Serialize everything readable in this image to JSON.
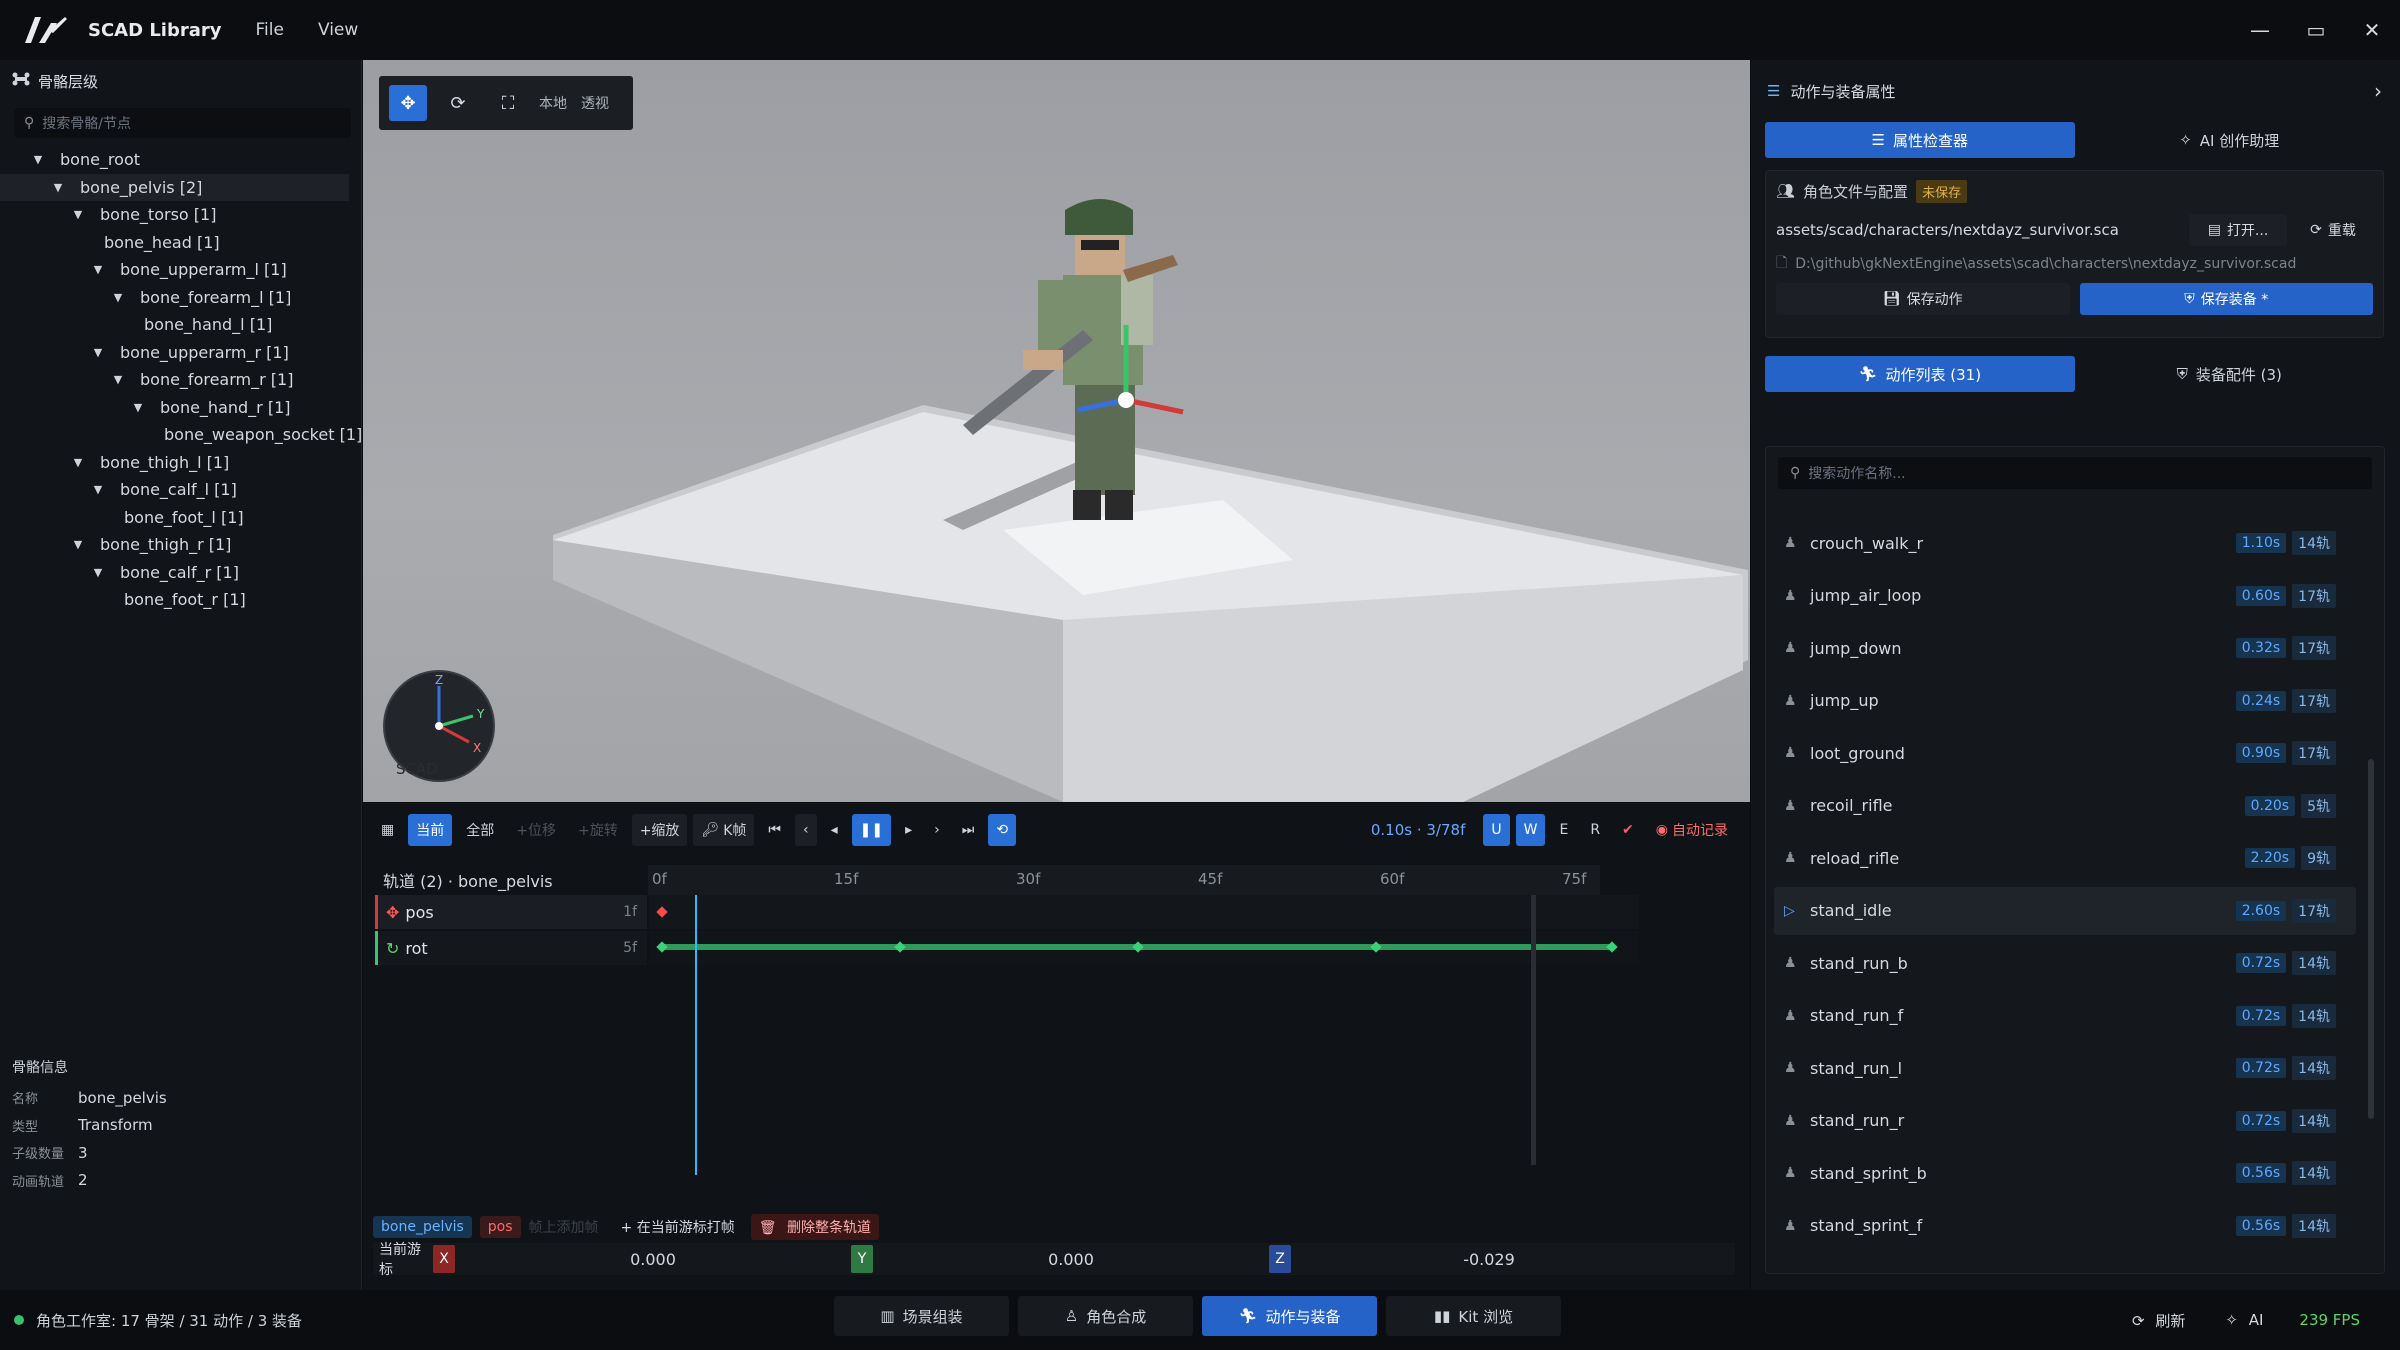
{
  "titlebar": {
    "app_title": "SCAD Library",
    "menu": [
      "File",
      "View"
    ],
    "min": "—",
    "max": "▭",
    "close": "✕"
  },
  "left": {
    "panel_title": "骨骼层级",
    "search_placeholder": "搜索骨骼/节点",
    "tree": [
      {
        "label": "bone_root",
        "depth": 0,
        "expand": true
      },
      {
        "label": "bone_pelvis  [2]",
        "depth": 1,
        "expand": true,
        "selected": true
      },
      {
        "label": "bone_torso  [1]",
        "depth": 2,
        "expand": true
      },
      {
        "label": "bone_head  [1]",
        "depth": 3,
        "expand": false
      },
      {
        "label": "bone_upperarm_l  [1]",
        "depth": 3,
        "expand": true
      },
      {
        "label": "bone_forearm_l  [1]",
        "depth": 4,
        "expand": true
      },
      {
        "label": "bone_hand_l  [1]",
        "depth": 5,
        "expand": false
      },
      {
        "label": "bone_upperarm_r  [1]",
        "depth": 3,
        "expand": true
      },
      {
        "label": "bone_forearm_r  [1]",
        "depth": 4,
        "expand": true
      },
      {
        "label": "bone_hand_r  [1]",
        "depth": 5,
        "expand": true
      },
      {
        "label": "bone_weapon_socket  [1]",
        "depth": 6,
        "expand": false
      },
      {
        "label": "bone_thigh_l  [1]",
        "depth": 2,
        "expand": true
      },
      {
        "label": "bone_calf_l  [1]",
        "depth": 3,
        "expand": true
      },
      {
        "label": "bone_foot_l  [1]",
        "depth": 4,
        "expand": false
      },
      {
        "label": "bone_thigh_r  [1]",
        "depth": 2,
        "expand": true
      },
      {
        "label": "bone_calf_r  [1]",
        "depth": 3,
        "expand": true
      },
      {
        "label": "bone_foot_r  [1]",
        "depth": 4,
        "expand": false
      }
    ],
    "info_title": "骨骼信息",
    "info": [
      {
        "k": "名称",
        "v": "bone_pelvis"
      },
      {
        "k": "类型",
        "v": "Transform"
      },
      {
        "k": "子级数量",
        "v": "3"
      },
      {
        "k": "动画轨道",
        "v": "2"
      }
    ]
  },
  "viewport": {
    "local": "本地",
    "persp": "透视",
    "gizmo_label": "SCAD",
    "axes": [
      "Z",
      "Y",
      "X"
    ]
  },
  "timeline": {
    "current": "当前",
    "all": "全部",
    "add_move": "+位移",
    "add_rot": "+旋转",
    "add_scale": "+缩放",
    "kframe": "K帧",
    "time": "0.10s · 3/78f",
    "w": "W",
    "e": "E",
    "r": "R",
    "auto_record": "自动记录",
    "track_header": "轨道 (2) · bone_pelvis",
    "ruler": [
      "0f",
      "15f",
      "30f",
      "45f",
      "60f",
      "75f"
    ],
    "tracks": [
      {
        "name": "pos",
        "count": "1f"
      },
      {
        "name": "rot",
        "count": "5f"
      }
    ],
    "edit": {
      "bone": "bone_pelvis",
      "channel": "pos",
      "hint": "帧上添加帧",
      "add_key": "+ 在当前游标打帧",
      "delete_track": "删除整条轨道"
    },
    "cursor_label": "当前游标",
    "values": {
      "x": "0.000",
      "y": "0.000",
      "z": "-0.029"
    }
  },
  "right": {
    "panel_title": "动作与装备属性",
    "tabs": [
      "属性检查器",
      "AI 创作助理"
    ],
    "card_title": "角色文件与配置",
    "unsaved": "未保存",
    "asset_path": "assets/scad/characters/nextdayz_survivor.sca",
    "open": "打开...",
    "reload": "重载",
    "full_path": "D:\\github\\gkNextEngine\\assets\\scad\\characters\\nextdayz_survivor.scad",
    "save_action": "保存动作",
    "save_equip": "保存装备 *",
    "list_tabs": [
      "动作列表 (31)",
      "装备配件 (3)"
    ],
    "list_search": "搜索动作名称...",
    "actions": [
      {
        "name": "crouch_walk_r",
        "dur": "1.10s",
        "tracks": "14轨"
      },
      {
        "name": "jump_air_loop",
        "dur": "0.60s",
        "tracks": "17轨"
      },
      {
        "name": "jump_down",
        "dur": "0.32s",
        "tracks": "17轨"
      },
      {
        "name": "jump_up",
        "dur": "0.24s",
        "tracks": "17轨"
      },
      {
        "name": "loot_ground",
        "dur": "0.90s",
        "tracks": "17轨"
      },
      {
        "name": "recoil_rifle",
        "dur": "0.20s",
        "tracks": "5轨"
      },
      {
        "name": "reload_rifle",
        "dur": "2.20s",
        "tracks": "9轨"
      },
      {
        "name": "stand_idle",
        "dur": "2.60s",
        "tracks": "17轨",
        "selected": true
      },
      {
        "name": "stand_run_b",
        "dur": "0.72s",
        "tracks": "14轨"
      },
      {
        "name": "stand_run_f",
        "dur": "0.72s",
        "tracks": "14轨"
      },
      {
        "name": "stand_run_l",
        "dur": "0.72s",
        "tracks": "14轨"
      },
      {
        "name": "stand_run_r",
        "dur": "0.72s",
        "tracks": "14轨"
      },
      {
        "name": "stand_sprint_b",
        "dur": "0.56s",
        "tracks": "14轨"
      },
      {
        "name": "stand_sprint_f",
        "dur": "0.56s",
        "tracks": "14轨"
      }
    ]
  },
  "status": {
    "text": "角色工作室: 17 骨架 / 31 动作 / 3 装备",
    "tabs": [
      "场景组装",
      "角色合成",
      "动作与装备",
      "Kit 浏览"
    ],
    "refresh": "刷新",
    "ai": "AI",
    "fps": "239 FPS"
  },
  "colors": {
    "accent": "#2563c9",
    "axis_x": "#d33a3a",
    "axis_y": "#3cc46a",
    "axis_z": "#3a6fe0",
    "fps": "#5fd36b"
  }
}
